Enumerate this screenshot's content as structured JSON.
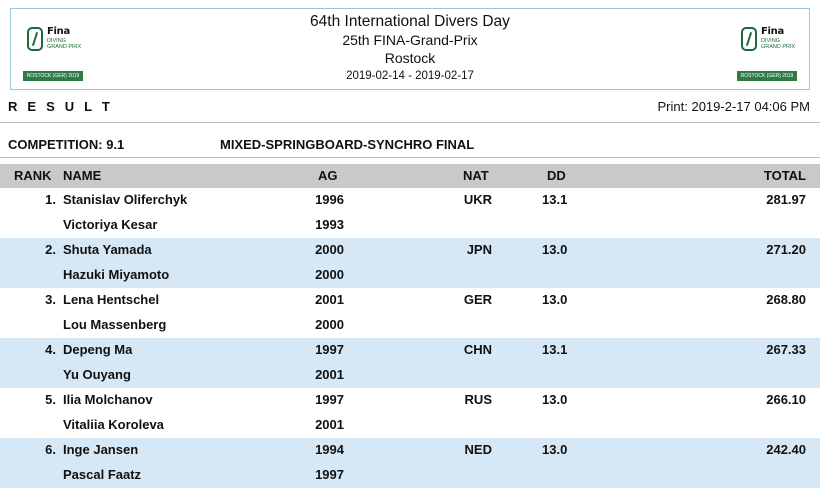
{
  "header": {
    "line1": "64th International Divers Day",
    "line2": "25th FINA-Grand-Prix",
    "line3": "Rostock",
    "line4": "2019-02-14 - 2019-02-17",
    "logo": {
      "brand": "Fina",
      "sub1": "DIVING",
      "sub2": "GRAND PRIX",
      "band": "ROSTOCK (GER) 2019"
    }
  },
  "result_label": "R E S U L T",
  "print_label": "Print: 2019-2-17 04:06 PM",
  "competition": {
    "label": "COMPETITION: 9.1",
    "title": "MIXED-SPRINGBOARD-SYNCHRO FINAL"
  },
  "columns": {
    "rank": "RANK",
    "name": "NAME",
    "ag": "AG",
    "nat": "NAT",
    "dd": "DD",
    "total": "TOTAL"
  },
  "rows": [
    {
      "rank": "1.",
      "name1": "Stanislav Oliferchyk",
      "ag1": "1996",
      "name2": "Victoriya Kesar",
      "ag2": "1993",
      "nat": "UKR",
      "dd": "13.1",
      "total": "281.97"
    },
    {
      "rank": "2.",
      "name1": "Shuta Yamada",
      "ag1": "2000",
      "name2": "Hazuki Miyamoto",
      "ag2": "2000",
      "nat": "JPN",
      "dd": "13.0",
      "total": "271.20"
    },
    {
      "rank": "3.",
      "name1": "Lena Hentschel",
      "ag1": "2001",
      "name2": "Lou Massenberg",
      "ag2": "2000",
      "nat": "GER",
      "dd": "13.0",
      "total": "268.80"
    },
    {
      "rank": "4.",
      "name1": "Depeng Ma",
      "ag1": "1997",
      "name2": "Yu Ouyang",
      "ag2": "2001",
      "nat": "CHN",
      "dd": "13.1",
      "total": "267.33"
    },
    {
      "rank": "5.",
      "name1": "Ilia Molchanov",
      "ag1": "1997",
      "name2": "Vitaliia Koroleva",
      "ag2": "2001",
      "nat": "RUS",
      "dd": "13.0",
      "total": "266.10"
    },
    {
      "rank": "6.",
      "name1": "Inge Jansen",
      "ag1": "1994",
      "name2": "Pascal Faatz",
      "ag2": "1997",
      "nat": "NED",
      "dd": "13.0",
      "total": "242.40"
    }
  ],
  "colors": {
    "header_border": "#9cc4dc",
    "table_header_bg": "#c9c9c9",
    "alt_row_bg": "#d6e7f5",
    "logo_green": "#2f7a45"
  }
}
